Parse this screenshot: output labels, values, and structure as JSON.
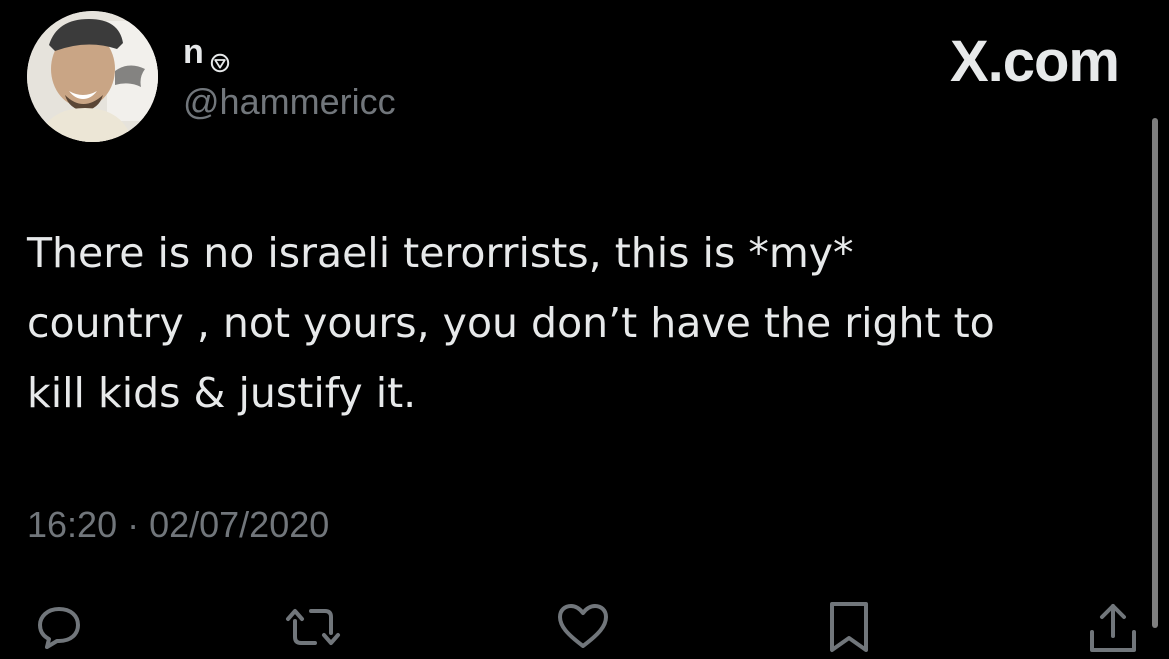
{
  "user": {
    "display_name": "n",
    "handle": "@hammericc",
    "avatar": "avatar-photo"
  },
  "brand": {
    "label": "X.com"
  },
  "tweet": {
    "lines": [
      "There is no israeli terorrists, this is *my*",
      "country , not yours, you don’t have the right to",
      "kill kids & justify it."
    ],
    "time": "16:20",
    "separator": "·",
    "date": "02/07/2020"
  },
  "actions": [
    {
      "name": "reply",
      "icon": "reply-icon"
    },
    {
      "name": "repost",
      "icon": "repost-icon"
    },
    {
      "name": "like",
      "icon": "heart-icon"
    },
    {
      "name": "bookmark",
      "icon": "bookmark-icon"
    },
    {
      "name": "share",
      "icon": "share-icon"
    }
  ],
  "colors": {
    "background": "#000000",
    "text": "#e7e9ea",
    "secondary": "#71767b",
    "icon": "#71767b"
  }
}
